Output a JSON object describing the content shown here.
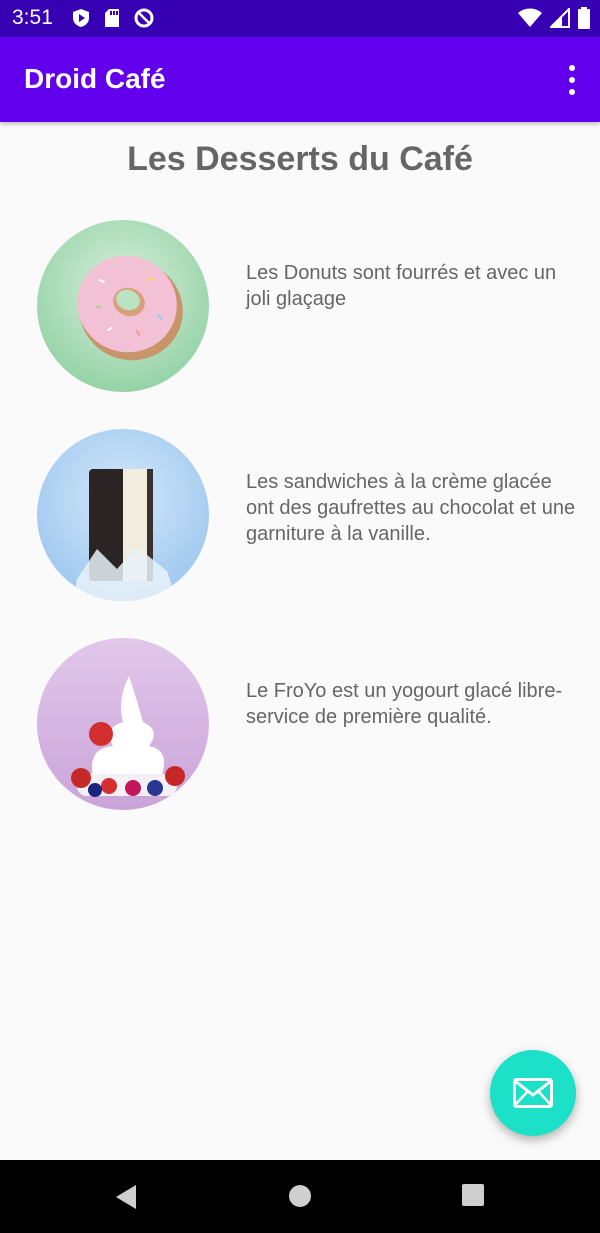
{
  "status_bar": {
    "time": "3:51",
    "left_icons": [
      "play-protect-icon",
      "sd-card-icon",
      "data-saver-icon"
    ],
    "right_icons": [
      "wifi-icon",
      "signal-icon",
      "battery-icon"
    ]
  },
  "app_bar": {
    "title": "Droid Café",
    "menu_icon": "more-vert-icon"
  },
  "page": {
    "heading": "Les Desserts du Café",
    "items": [
      {
        "name": "donut",
        "description": "Les Donuts sont fourrés et avec un joli glaçage"
      },
      {
        "name": "ice-cream-sandwich",
        "description": "Les sandwiches à la crème glacée ont des gaufrettes au chocolat et une garniture à la vanille."
      },
      {
        "name": "froyo",
        "description": "Le FroYo est un yogourt glacé libre-service de première qualité."
      }
    ]
  },
  "fab": {
    "icon": "mail-icon"
  },
  "nav_bar": {
    "icons": [
      "back-icon",
      "home-icon",
      "recents-icon"
    ]
  },
  "colors": {
    "status_bar": "#3700b3",
    "app_bar": "#6200ee",
    "fab": "#1de0c8",
    "text": "#666666",
    "background": "#fafafa"
  }
}
